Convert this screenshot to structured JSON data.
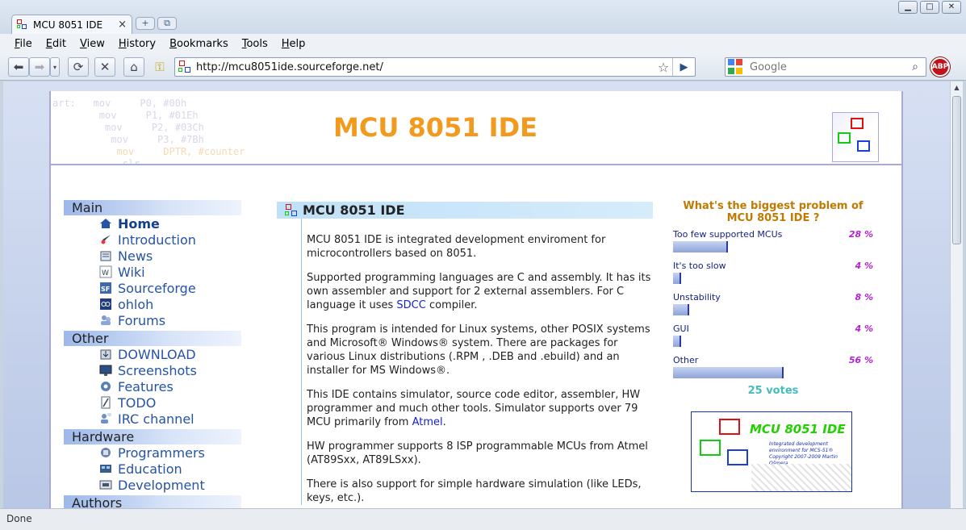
{
  "browser": {
    "tab_title": "MCU 8051 IDE",
    "menu": [
      "File",
      "Edit",
      "View",
      "History",
      "Bookmarks",
      "Tools",
      "Help"
    ],
    "url": "http://mcu8051ide.sourceforge.net/",
    "search_placeholder": "Google",
    "abp_label": "ABP",
    "status": "Done"
  },
  "header": {
    "title": "MCU 8051 IDE",
    "asm_lines": [
      "art:   mov     P0, #00h",
      "        mov     P1, #01Eh",
      "         mov     P2, #03Ch",
      "          mov     P3, #7Bh",
      "           mov     DPTR, #counter",
      "            clr     "
    ]
  },
  "sidebar": {
    "sections": [
      {
        "title": "Main",
        "items": [
          "Home",
          "Introduction",
          "News",
          "Wiki",
          "Sourceforge",
          "ohloh",
          "Forums"
        ]
      },
      {
        "title": "Other",
        "items": [
          "DOWNLOAD",
          "Screenshots",
          "Features",
          "TODO",
          "IRC channel"
        ]
      },
      {
        "title": "Hardware",
        "items": [
          "Programmers",
          "Education",
          "Development"
        ]
      },
      {
        "title": "Authors",
        "items": []
      }
    ]
  },
  "main": {
    "heading": "MCU 8051 IDE",
    "p1": "MCU 8051 IDE is integrated development enviroment for microcontrollers based on 8051.",
    "p2_before": "Supported programming languages are C and assembly. It has its own assembler and support for 2 external assemblers. For C language it uses ",
    "p2_link": "SDCC",
    "p2_after": " compiler.",
    "p3": "This program is intended for Linux systems, other POSIX systems and Microsoft® Windows® system. There are packages for various Linux distributions (.RPM , .DEB and .ebuild) and an installer for MS Windows®.",
    "p4_before": "This IDE contains simulator, source code editor, assembler, HW programmer and much other tools. Simulator supports over 79 MCU primarily from ",
    "p4_link": "Atmel",
    "p4_after": ".",
    "p5": "HW programmer supports 8 ISP programmable MCUs from Atmel (AT89Sxx, AT89LSxx).",
    "p6": "There is also support for simple hardware simulation (like LEDs, keys, etc.)."
  },
  "poll": {
    "question": "What's the biggest problem of MCU 8051 IDE ?",
    "options": [
      {
        "label": "Too few supported MCUs",
        "pct_text": "28 %",
        "pct": 28
      },
      {
        "label": "It's too slow",
        "pct_text": "4 %",
        "pct": 4
      },
      {
        "label": "Unstability",
        "pct_text": "8 %",
        "pct": 8
      },
      {
        "label": "GUI",
        "pct_text": "4 %",
        "pct": 4
      },
      {
        "label": "Other",
        "pct_text": "56 %",
        "pct": 56
      }
    ],
    "votes": "25 votes"
  },
  "banner": {
    "title": "MCU 8051 IDE",
    "subtitle_1": "Integrated development",
    "subtitle_2": "environment for MCS-51®",
    "subtitle_3": "Copyright 2007-2009 Martin Ošmera"
  },
  "colors": {
    "accent": "#f29a1d",
    "link": "#2553a6",
    "poll_question": "#c17a00",
    "poll_pct": "#b51fd0",
    "votes": "#43bdbd"
  }
}
